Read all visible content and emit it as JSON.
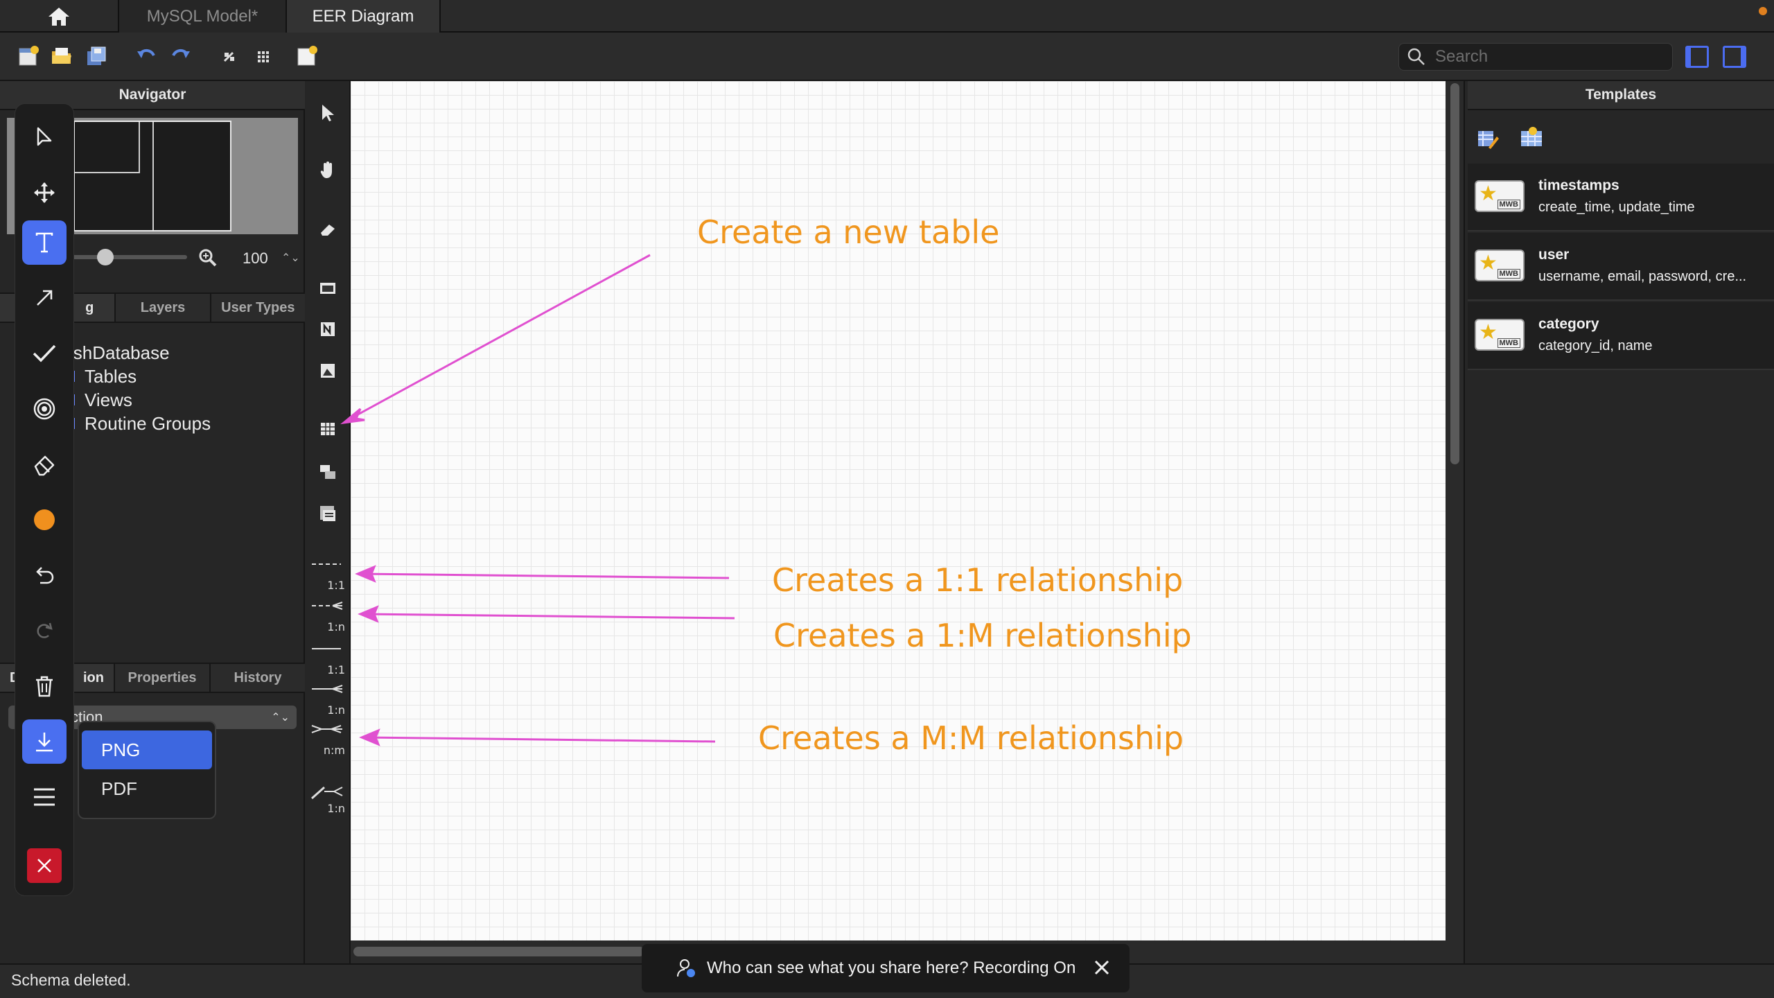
{
  "tabs": {
    "model": "MySQL Model*",
    "eer": "EER Diagram"
  },
  "search": {
    "placeholder": "Search",
    "value": ""
  },
  "navigator": {
    "title": "Navigator",
    "zoom": "100"
  },
  "left_tabs_top": [
    "g",
    "Layers",
    "User Types"
  ],
  "left_tabs_bottom": [
    "ion",
    "Properties",
    "History"
  ],
  "left_tabs_bottom_first_partial": "D",
  "tree": {
    "root": "ishDatabase",
    "children": [
      "Tables",
      "Views",
      "Routine Groups"
    ]
  },
  "section_select": "ction",
  "export_menu": {
    "items": [
      "PNG",
      "PDF"
    ],
    "selected": "PNG"
  },
  "relationship_tools": [
    "1:1",
    "1:n",
    "1:1",
    "1:n",
    "n:m",
    "1:n"
  ],
  "annotations": {
    "new_table": "Create a new table",
    "one_one": "Creates a 1:1 relationship",
    "one_many": "Creates a 1:M relationship",
    "many_many": "Creates a M:M relationship"
  },
  "templates": {
    "title": "Templates",
    "items": [
      {
        "name": "timestamps",
        "columns": "create_time, update_time"
      },
      {
        "name": "user",
        "columns": "username, email, password, cre..."
      },
      {
        "name": "category",
        "columns": "category_id, name"
      }
    ],
    "badge": "MWB"
  },
  "status": "Schema deleted.",
  "recording_notice": "Who can see what you share here? Recording On",
  "colors": {
    "annotation_text": "#f0961e",
    "annotation_arrow": "#e050d0",
    "accent": "#4a6ff0",
    "menu_selected": "#3d67e0",
    "close_red": "#c8192b",
    "active_tool_orange": "#f0901e"
  }
}
